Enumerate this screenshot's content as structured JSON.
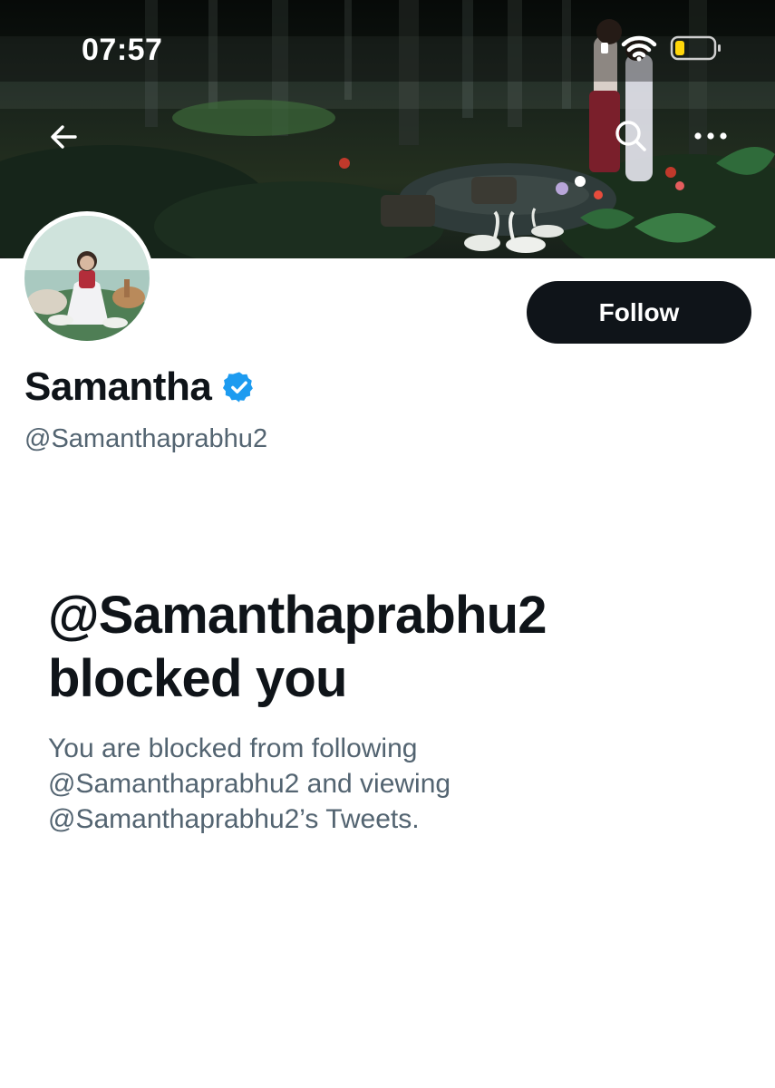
{
  "status_bar": {
    "time": "07:57"
  },
  "colors": {
    "text_primary": "#0f1419",
    "text_secondary": "#536471",
    "verified_blue": "#1d9bf0",
    "battery_yellow": "#ffd60a"
  },
  "icons": {
    "back": "arrow-left-icon",
    "search": "search-icon",
    "more": "more-horizontal-icon",
    "verified": "verified-badge-icon"
  },
  "profile": {
    "display_name": "Samantha",
    "handle": "@Samanthaprabhu2",
    "follow_label": "Follow"
  },
  "blocked": {
    "title_line1": "@Samanthaprabhu2",
    "title_line2": "blocked you",
    "description": "You are blocked from following @Samanthaprabhu2 and viewing @Samanthaprabhu2’s Tweets."
  }
}
